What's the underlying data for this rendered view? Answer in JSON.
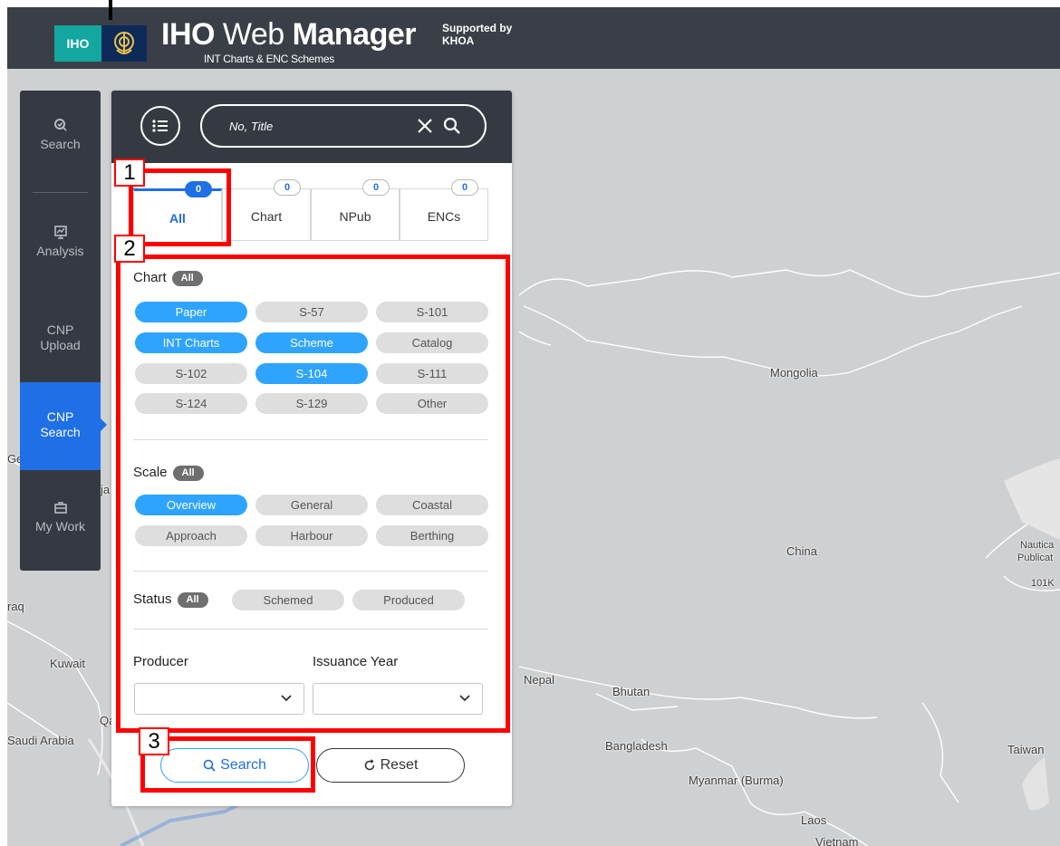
{
  "header": {
    "logo_text": "IHO",
    "title_bold_1": "IHO",
    "title_light": "Web",
    "title_bold_2": "Manager",
    "subtitle": "INT Charts & ENC Schemes",
    "supported_line1": "Supported by",
    "supported_line2": "KHOA"
  },
  "nav": {
    "items": [
      {
        "label": "Search",
        "icon": "search-icon"
      },
      {
        "label": "Analysis",
        "icon": "analysis-icon"
      },
      {
        "label_line1": "CNP",
        "label_line2": "Upload"
      },
      {
        "label_line1": "CNP",
        "label_line2": "Search",
        "active": true
      },
      {
        "label": "My Work",
        "icon": "briefcase-icon"
      }
    ]
  },
  "search": {
    "placeholder": "No, Title"
  },
  "tabs": [
    {
      "label": "All",
      "count": "0",
      "active": true
    },
    {
      "label": "Chart",
      "count": "0"
    },
    {
      "label": "NPub",
      "count": "0"
    },
    {
      "label": "ENCs",
      "count": "0"
    }
  ],
  "chart_filter": {
    "title": "Chart",
    "all_label": "All",
    "options": [
      {
        "label": "Paper",
        "selected": true
      },
      {
        "label": "S-57",
        "selected": false
      },
      {
        "label": "S-101",
        "selected": false
      },
      {
        "label": "INT Charts",
        "selected": true
      },
      {
        "label": "Scheme",
        "selected": true
      },
      {
        "label": "Catalog",
        "selected": false
      },
      {
        "label": "S-102",
        "selected": false
      },
      {
        "label": "S-104",
        "selected": true
      },
      {
        "label": "S-111",
        "selected": false
      },
      {
        "label": "S-124",
        "selected": false
      },
      {
        "label": "S-129",
        "selected": false
      },
      {
        "label": "Other",
        "selected": false
      }
    ]
  },
  "scale_filter": {
    "title": "Scale",
    "all_label": "All",
    "options": [
      {
        "label": "Overview",
        "selected": true
      },
      {
        "label": "General",
        "selected": false
      },
      {
        "label": "Coastal",
        "selected": false
      },
      {
        "label": "Approach",
        "selected": false
      },
      {
        "label": "Harbour",
        "selected": false
      },
      {
        "label": "Berthing",
        "selected": false
      }
    ]
  },
  "status_filter": {
    "title": "Status",
    "all_label": "All",
    "options": [
      {
        "label": "Schemed",
        "selected": false
      },
      {
        "label": "Produced",
        "selected": false
      }
    ]
  },
  "producer": {
    "label": "Producer",
    "value": ""
  },
  "issuance_year": {
    "label": "Issuance Year",
    "value": ""
  },
  "buttons": {
    "search": "Search",
    "reset": "Reset"
  },
  "annotations": [
    "1",
    "2",
    "3"
  ],
  "map_labels": {
    "mongolia": "Mongolia",
    "china": "China",
    "nepal": "Nepal",
    "bhutan": "Bhutan",
    "bangladesh": "Bangladesh",
    "myanmar": "Myanmar (Burma)",
    "laos": "Laos",
    "vietnam": "Vietnam",
    "taiwan": "Taiwan",
    "kuwait": "Kuwait",
    "saudi": "Saudi Arabia",
    "iraq": "raq",
    "qa": "Qa",
    "ja": "ja",
    "geo": "Geo",
    "nautical": "Nautica",
    "publicat": "Publicat",
    "code": "101K"
  },
  "colors": {
    "accent": "#1f6fe6",
    "selected_pill": "#2fa4ff",
    "dark_panel": "#353a42",
    "annotation_red": "#ff0000"
  }
}
